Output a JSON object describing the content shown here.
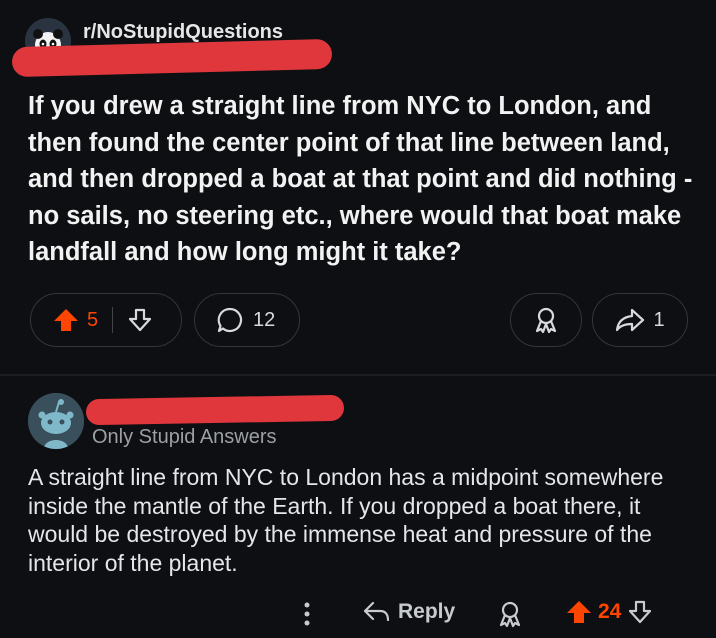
{
  "post": {
    "subreddit": "r/NoStupidQuestions",
    "title": "If you drew a straight line from NYC to London, and then found the center point of that line between land, and then dropped a boat at that point and did nothing -no sails, no steering etc., where would that boat make landfall and how long might it take?",
    "votes": "5",
    "comments": "12",
    "shares": "1"
  },
  "comment": {
    "flair": "Only Stupid Answers",
    "body": "A straight line from NYC to London has a midpoint somewhere inside the mantle of the Earth. If you dropped a boat there, it would be destroyed by the immense heat and pressure of the interior of the planet.",
    "reply_label": "Reply",
    "votes": "24"
  },
  "colors": {
    "background": "#0d0f12",
    "upvote_orange": "#ff4500",
    "redaction_red": "#e0373d",
    "border": "#343536"
  },
  "icons": {
    "subreddit_avatar": "panda-avatar-icon",
    "user_avatar": "snoo-avatar-icon",
    "upvote": "arrow-up-icon",
    "downvote": "arrow-down-icon",
    "comment": "speech-bubble-icon",
    "award": "award-icon",
    "share": "share-arrow-icon",
    "more": "vertical-dots-icon",
    "reply": "reply-arrow-icon"
  }
}
